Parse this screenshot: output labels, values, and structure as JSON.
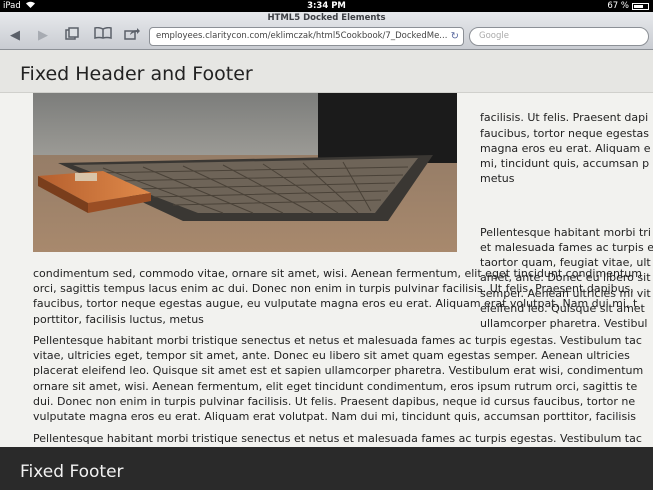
{
  "status_bar": {
    "carrier": "iPad",
    "time": "3:34 PM",
    "battery": "67 %",
    "battery_level": 0.67
  },
  "browser": {
    "page_title": "HTML5 Docked Elements",
    "url": "employees.claritycon.com/eklimczak/html5Cookbook/7_DockedMe...",
    "search_placeholder": "Google"
  },
  "header": {
    "title": "Fixed Header and Footer"
  },
  "sidebar_paragraphs": [
    "facilisis. Ut felis. Praesent dapi\nfaucibus, tortor neque egestas\nmagna eros eu erat. Aliquam e\nmi, tincidunt quis, accumsan p\nmetus",
    "Pellentesque habitant morbi tri\net malesuada fames ac turpis e\ntaortor quam, feugiat vitae, ult\namet, ante. Donec eu libero sit\nsemper. Aenean ultricies mi vit\neleifend leo. Quisque sit amet\nullamcorper pharetra. Vestibul"
  ],
  "paragraphs": [
    "condimentum sed, commodo vitae, ornare sit amet, wisi. Aenean fermentum, elit eget tincidunt condimentum\norci, sagittis tempus lacus enim ac dui. Donec non enim in turpis pulvinar facilisis. Ut felis. Praesent dapibus,\nfaucibus, tortor neque egestas augue, eu vulputate magna eros eu erat. Aliquam erat volutpat. Nam dui mi, t\nporttitor, facilisis luctus, metus",
    "Pellentesque habitant morbi tristique senectus et netus et malesuada fames ac turpis egestas. Vestibulum tac\nvitae, ultricies eget, tempor sit amet, ante. Donec eu libero sit amet quam egestas semper. Aenean ultricies\nplacerat eleifend leo. Quisque sit amet est et sapien ullamcorper pharetra. Vestibulum erat wisi, condimentum\nornare sit amet, wisi. Aenean fermentum, elit eget tincidunt condimentum, eros ipsum rutrum orci, sagittis te\ndui. Donec non enim in turpis pulvinar facilisis. Ut felis. Praesent dapibus, neque id cursus faucibus, tortor ne\nvulputate magna eros eu erat. Aliquam erat volutpat. Nam dui mi, tincidunt quis, accumsan porttitor, facilisis",
    "Pellentesque habitant morbi tristique senectus et netus et malesuada fames ac turpis egestas. Vestibulum tac"
  ],
  "footer": {
    "title": "Fixed Footer"
  }
}
